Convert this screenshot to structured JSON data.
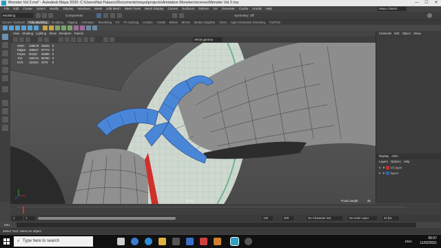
{
  "window": {
    "title": "Monster Vol 2.ma* - Autodesk Maya 2020: C:\\Users\\Nat Palazzo\\Documents\\maya\\projects\\Artstation Monsters\\scenes\\Monster Vol 2.ma",
    "workspace_label": "Maya Classic",
    "controls": [
      "—",
      "☐",
      "✕"
    ]
  },
  "menubar": {
    "items": [
      "File",
      "Edit",
      "Create",
      "Select",
      "Modify",
      "Display",
      "Windows",
      "Mesh",
      "Edit Mesh",
      "Mesh Tools",
      "Mesh Display",
      "Curves",
      "Surfaces",
      "Deform",
      "UV",
      "Generate",
      "Cache",
      "Arnold",
      "Help"
    ]
  },
  "statusline": {
    "mode": "Modeling",
    "components_label": "Components",
    "symmetry_label": "Symmetry: Off"
  },
  "shelf": {
    "tabs": [
      "Curves / Surfaces",
      "Poly Modeling",
      "Sculpting",
      "Rigging",
      "Animation",
      "Rendering",
      "FX",
      "FX Caching",
      "Custom",
      "Arnold",
      "Bifrost",
      "MASH",
      "Motion Graphics",
      "XGen",
      "Xgen Interactive Grooming",
      "TURTLE"
    ],
    "active_tab": 1
  },
  "panel": {
    "menu": [
      "View",
      "Shading",
      "Lighting",
      "Show",
      "Renderer",
      "Panels"
    ],
    "camera_label": "persp",
    "focal_length_label": "Focal Length:",
    "focal_length_value": "35",
    "hud_rows": [
      [
        "Verts:",
        "108478",
        "48434",
        "0"
      ],
      [
        "Edges:",
        "198447",
        "97774",
        "0"
      ],
      [
        "Faces:",
        "90149",
        "49390",
        "0"
      ],
      [
        "Tris:",
        "180744",
        "98780",
        "0"
      ],
      [
        "UVs:",
        "115224",
        "4073",
        "0"
      ]
    ]
  },
  "channel_box": {
    "menu": [
      "Channels",
      "Edit",
      "Object",
      "Show"
    ]
  },
  "layers": {
    "tabs": [
      "Display",
      "Anim"
    ],
    "menu": [
      "Layers",
      "Options",
      "Help"
    ],
    "rows": [
      {
        "v": "V",
        "p": "P",
        "name": "ref_layer",
        "color": "#c03030"
      },
      {
        "v": "V",
        "p": "P",
        "name": "layer1",
        "color": "#3a5fa0"
      }
    ]
  },
  "time": {
    "start": "1",
    "end": "120",
    "range_start": "1",
    "range_end": "120",
    "range_end_max": "200",
    "fps": "24 fps",
    "no_character_set": "No Character Set",
    "no_anim_layer": "No Anim Layer"
  },
  "mel": {
    "label": "MEL"
  },
  "helpline": {
    "text": "Select Tool: select an object"
  },
  "taskbar": {
    "search_placeholder": "Type here to search",
    "lang": "ENG",
    "time": "06:07",
    "date": "11/02/2021"
  },
  "colors": {
    "selection": "#4a86d8",
    "mesh": "#8a8a8a",
    "wire": "#3e3e3e",
    "accent_maya": "#2aa3c4"
  }
}
